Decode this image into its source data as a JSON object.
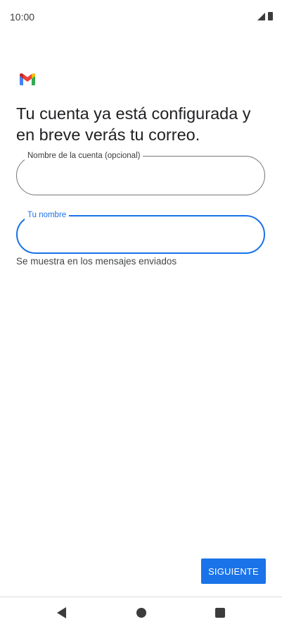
{
  "status_bar": {
    "time": "10:00"
  },
  "setup": {
    "heading": "Tu cuenta ya está configurada y en breve verás tu correo.",
    "account_name_field": {
      "label": "Nombre de la cuenta (opcional)",
      "value": ""
    },
    "your_name_field": {
      "label": "Tu nombre",
      "value": "",
      "helper": "Se muestra en los mensajes enviados"
    },
    "next_label": "SIGUIENTE"
  },
  "colors": {
    "accent": "#1a73e8",
    "outline": "#747775",
    "text": "#202124"
  },
  "icons": {
    "logo": "gmail-logo",
    "status": [
      "signal-icon",
      "battery-icon"
    ],
    "nav": [
      "back-icon",
      "home-icon",
      "recents-icon"
    ]
  }
}
